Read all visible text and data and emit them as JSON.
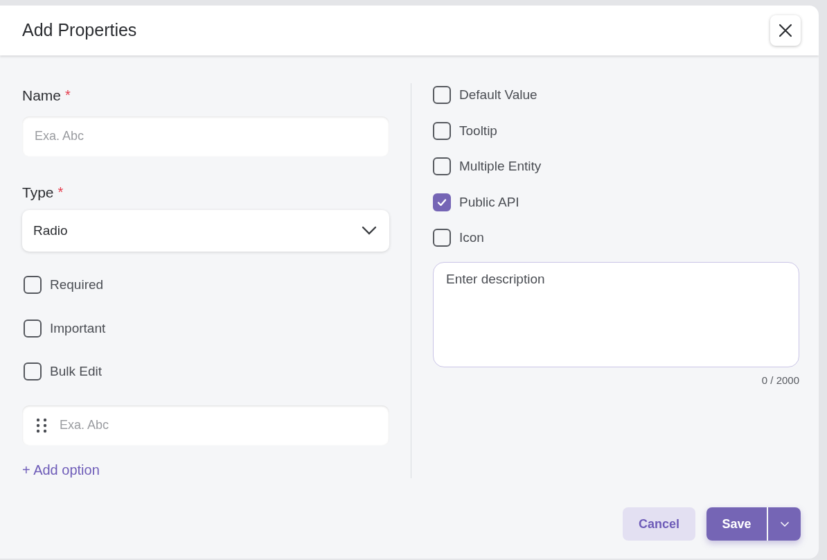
{
  "dialog": {
    "title": "Add Properties"
  },
  "left": {
    "name_field": {
      "label": "Name",
      "required_mark": "*",
      "placeholder": "Exa. Abc"
    },
    "type_field": {
      "label": "Type",
      "required_mark": "*",
      "value": "Radio"
    },
    "checkboxes": [
      {
        "label": "Required",
        "checked": false
      },
      {
        "label": "Important",
        "checked": false
      },
      {
        "label": "Bulk Edit",
        "checked": false
      }
    ],
    "options": [
      {
        "placeholder": "Exa. Abc"
      }
    ],
    "add_option": "+ Add option"
  },
  "right": {
    "checkboxes": [
      {
        "label": "Default Value",
        "checked": false
      },
      {
        "label": "Tooltip",
        "checked": false
      },
      {
        "label": "Multiple Entity",
        "checked": false
      },
      {
        "label": "Public API",
        "checked": true
      },
      {
        "label": "Icon",
        "checked": false
      }
    ],
    "description": {
      "placeholder": "Enter description",
      "counter": "0 / 2000"
    }
  },
  "footer": {
    "cancel": "Cancel",
    "save": "Save"
  }
}
